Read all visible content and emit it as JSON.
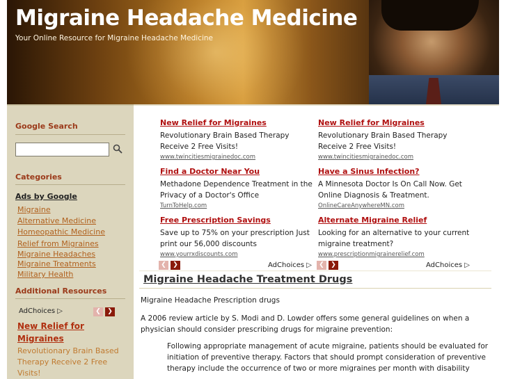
{
  "header": {
    "title": "Migraine Headache Medicine",
    "tagline": "Your Online Resource for Migraine Headache Medicine"
  },
  "sidebar": {
    "search_heading": "Google Search",
    "search_icon": "magnifier-icon",
    "categories_heading": "Categories",
    "ads_by_google": "Ads by Google",
    "category_links": [
      "Migraine",
      "Alternative Medicine",
      "Homeopathic Medicine",
      "Relief from Migraines",
      "Migraine Headaches",
      "Migraine Treatments",
      "Military Health"
    ],
    "additional_heading": "Additional Resources",
    "adchoices": "AdChoices",
    "ad_title": "New Relief for Migraines",
    "ad_text": "Revolutionary Brain Based Therapy Receive 2 Free Visits!"
  },
  "ads": [
    {
      "title": "New Relief for Migraines",
      "text": "Revolutionary Brain Based Therapy Receive 2 Free Visits!",
      "url": "www.twincitiesmigrainedoc.com"
    },
    {
      "title": "New Relief for Migraines",
      "text": "Revolutionary Brain Based Therapy Receive 2 Free Visits!",
      "url": "www.twincitiesmigrainedoc.com"
    },
    {
      "title": "Find a Doctor Near You",
      "text": "Methadone Dependence Treatment in the Privacy of a Doctor's Office",
      "url": "TurnToHelp.com"
    },
    {
      "title": "Have a Sinus Infection?",
      "text": "A Minnesota Doctor Is On Call Now. Get Online Diagnosis & Treatment.",
      "url": "OnlineCareAnywhereMN.com"
    },
    {
      "title": "Free Prescription Savings",
      "text": "Save up to 75% on your prescription Just print our 56,000 discounts",
      "url": "www.yourrxdiscounts.com"
    },
    {
      "title": "Alternate Migraine Relief",
      "text": "Looking for an alternative to your current migraine treatment?",
      "url": "www.prescriptionmigrainerelief.com"
    }
  ],
  "adchoices_label": "AdChoices",
  "article": {
    "title": "Migraine Headache Treatment Drugs",
    "subtitle": "Migraine Headache Prescription drugs",
    "paragraph1": "A 2006 review article by S. Modi and D. Lowder offers some general guidelines on when a physician should consider prescribing drugs for migraine prevention:",
    "quote": "Following appropriate management of acute migraine, patients should be evaluated for initiation of preventive therapy. Factors that should prompt consideration of preventive therapy include the occurrence of two or more migraines per month with disability"
  },
  "colors": {
    "sidebar_bg": "#dcd6bd",
    "heading_red": "#9b3a1a",
    "link_orange": "#b0601d",
    "ad_title_red": "#b01010"
  }
}
